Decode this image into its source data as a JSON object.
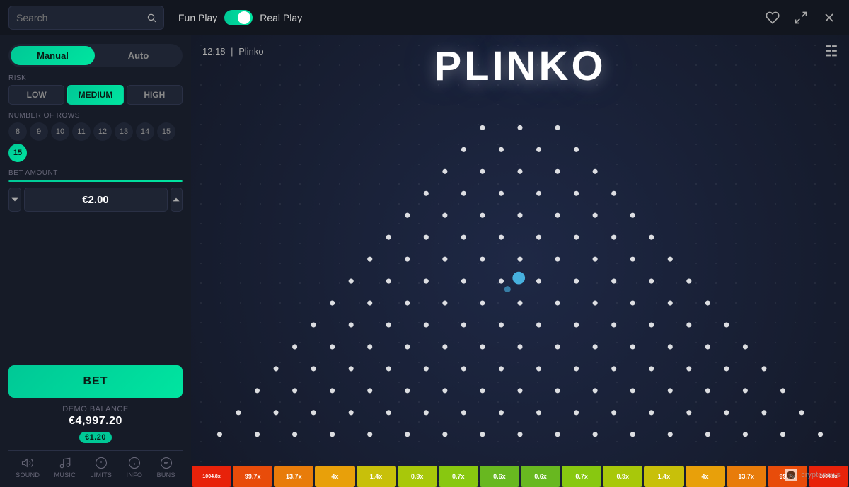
{
  "header": {
    "search_placeholder": "Search",
    "fun_play_label": "Fun Play",
    "real_play_label": "Real Play",
    "favorite_icon": "♥",
    "fullscreen_icon": "⤢",
    "close_icon": "✕"
  },
  "sidebar": {
    "tab_manual": "Manual",
    "tab_auto": "Auto",
    "risk_label": "RISK",
    "risk_options": [
      "LOW",
      "MEDIUM",
      "HIGH"
    ],
    "active_risk": "MEDIUM",
    "rows_label": "NUMBER OF ROWS",
    "row_options": [
      "8",
      "9",
      "10",
      "11",
      "12",
      "13",
      "14",
      "15",
      "15"
    ],
    "active_row": "15",
    "bet_label": "BET AMOUNT",
    "bet_value": "€2.00",
    "bet_button": "BET",
    "demo_balance_label": "DEMO BALANCE",
    "demo_balance_value": "€4,997.20",
    "demo_chip": "€1.20"
  },
  "footer": {
    "items": [
      "SOUND",
      "MUSIC",
      "LIMITS",
      "INFO",
      "BUNS"
    ]
  },
  "game": {
    "time": "12:18",
    "separator": "|",
    "game_name": "Plinko",
    "title": "PLINKO"
  },
  "multipliers": [
    {
      "value": "1004.8x",
      "color": "#e8220a"
    },
    {
      "value": "99.7x",
      "color": "#e84c0a"
    },
    {
      "value": "13.7x",
      "color": "#e87c0a"
    },
    {
      "value": "4x",
      "color": "#e8a00a"
    },
    {
      "value": "1.4x",
      "color": "#c8c00a"
    },
    {
      "value": "0.9x",
      "color": "#a8c80a"
    },
    {
      "value": "0.7x",
      "color": "#88c810"
    },
    {
      "value": "0.6x",
      "color": "#68b820"
    },
    {
      "value": "0.6x",
      "color": "#68b820"
    },
    {
      "value": "0.7x",
      "color": "#88c810"
    },
    {
      "value": "0.9x",
      "color": "#a8c80a"
    },
    {
      "value": "1.4x",
      "color": "#c8c00a"
    },
    {
      "value": "4x",
      "color": "#e8a00a"
    },
    {
      "value": "13.7x",
      "color": "#e87c0a"
    },
    {
      "value": "99.7x",
      "color": "#e84c0a"
    },
    {
      "value": "1004.8x",
      "color": "#e8220a"
    }
  ]
}
